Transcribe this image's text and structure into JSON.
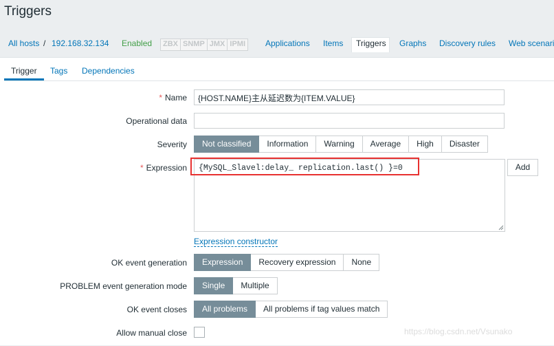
{
  "page": {
    "title": "Triggers"
  },
  "nav": {
    "all_hosts": "All hosts",
    "separator": "/",
    "host": "192.168.32.134",
    "status": "Enabled",
    "badges": [
      "ZBX",
      "SNMP",
      "JMX",
      "IPMI"
    ],
    "tabs": [
      "Applications",
      "Items",
      "Triggers",
      "Graphs",
      "Discovery rules",
      "Web scenari"
    ],
    "active_tab": "Triggers"
  },
  "subtabs": {
    "items": [
      "Trigger",
      "Tags",
      "Dependencies"
    ],
    "active": "Trigger"
  },
  "form": {
    "name": {
      "label": "Name",
      "required": "*",
      "value": "{HOST.NAME}主从延迟数为{ITEM.VALUE}"
    },
    "operational_data": {
      "label": "Operational data",
      "value": ""
    },
    "severity": {
      "label": "Severity",
      "options": [
        "Not classified",
        "Information",
        "Warning",
        "Average",
        "High",
        "Disaster"
      ],
      "selected": "Not classified"
    },
    "expression": {
      "label": "Expression",
      "required": "*",
      "value": "{MySQL_Slavel:delay_ replication.last() }=0",
      "add_label": "Add",
      "constructor_link": "Expression constructor"
    },
    "ok_event_generation": {
      "label": "OK event generation",
      "options": [
        "Expression",
        "Recovery expression",
        "None"
      ],
      "selected": "Expression"
    },
    "problem_mode": {
      "label": "PROBLEM event generation mode",
      "options": [
        "Single",
        "Multiple"
      ],
      "selected": "Single"
    },
    "ok_event_closes": {
      "label": "OK event closes",
      "options": [
        "All problems",
        "All problems if tag values match"
      ],
      "selected": "All problems"
    },
    "manual_close": {
      "label": "Allow manual close",
      "checked": false
    }
  },
  "watermark": "https://blog.csdn.net/Vsunako",
  "colors": {
    "link": "#0275b8",
    "active_segment": "#768d99",
    "enabled": "#429e47",
    "required": "#e45959",
    "highlight": "#e8302f"
  }
}
